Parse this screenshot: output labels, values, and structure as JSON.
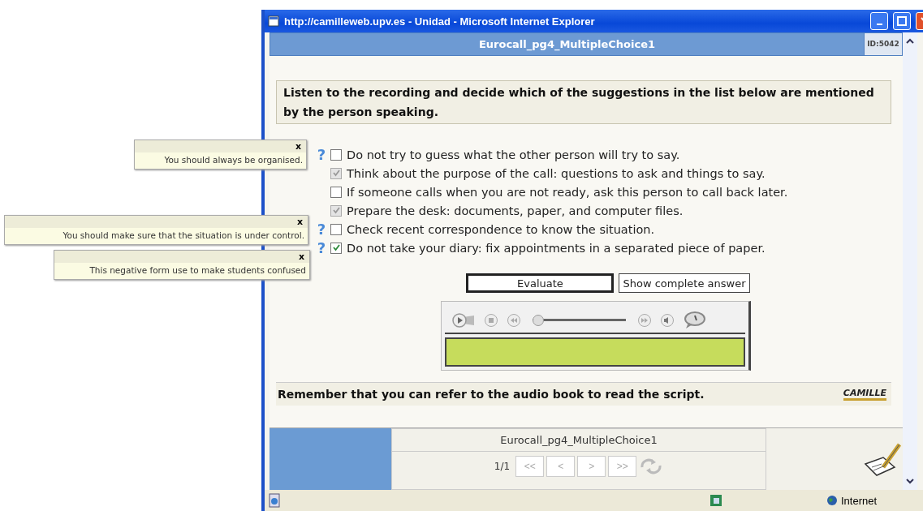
{
  "window": {
    "title": "http://camilleweb.upv.es - Unidad - Microsoft Internet Explorer"
  },
  "header": {
    "title": "Eurocall_pg4_MultipleChoice1",
    "id": "ID:5042"
  },
  "instruction": "Listen to the recording and decide which of the suggestions in the list below are mentioned by the person speaking.",
  "options": [
    {
      "hint": "?",
      "text": "Do not try to guess what the other person will try to say.",
      "checked": false,
      "disabled": false
    },
    {
      "text": "Think about the purpose of the call: questions to ask and things to say.",
      "checked": true,
      "disabled": true
    },
    {
      "text": "If someone calls when you are not ready, ask this person to call back later.",
      "checked": false,
      "disabled": false
    },
    {
      "text": "Prepare the desk: documents, paper, and computer files.",
      "checked": true,
      "disabled": true
    },
    {
      "hint": "?",
      "text": "Check recent correspondence to know the situation.",
      "checked": false,
      "disabled": false
    },
    {
      "hint": "?",
      "text": "Do not take your diary: fix appointments in a separated piece of paper.",
      "checked": true,
      "disabled": false
    }
  ],
  "tooltips": [
    {
      "close": "x",
      "text": "You should always be organised."
    },
    {
      "close": "x",
      "text": "You should make sure that the situation is under control."
    },
    {
      "close": "x",
      "text": "This negative form use to make students confused"
    }
  ],
  "buttons": [
    {
      "label": "Evaluate",
      "focused": true
    },
    {
      "label": "Show complete answer",
      "focused": false
    }
  ],
  "player": {
    "level": 0
  },
  "note": "Remember that you can refer to the audio book to read the script.",
  "logo": "CAMILLE",
  "pager": {
    "title": "Eurocall_pg4_MultipleChoice1",
    "page": "1/1",
    "buttons": [
      "<<",
      "<",
      ">",
      ">>"
    ]
  },
  "status_bar": {
    "zone": "Internet"
  }
}
